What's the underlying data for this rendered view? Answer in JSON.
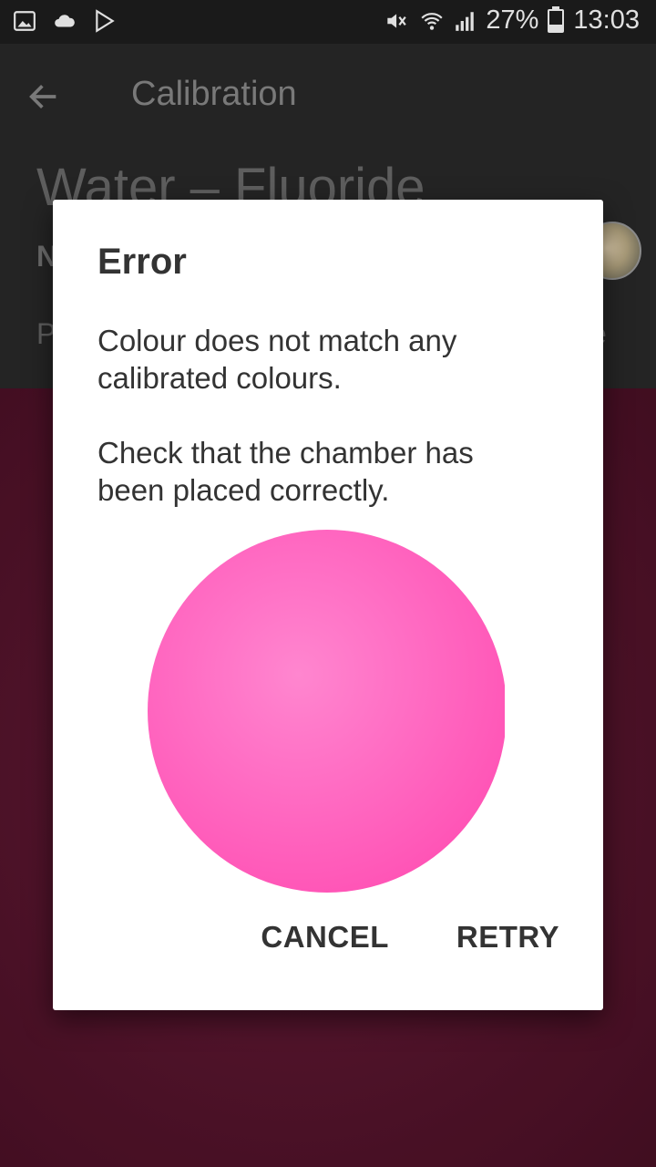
{
  "status_bar": {
    "battery": "27%",
    "time": "13:03",
    "icons": [
      "gallery-icon",
      "cloud-icon",
      "play-store-icon",
      "mute-icon",
      "wifi-icon",
      "signal-icon",
      "battery-icon"
    ]
  },
  "app_bar": {
    "title": "Calibration",
    "back_icon": "arrow-left-icon"
  },
  "background": {
    "heading": "Water – Fluoride",
    "bold_label": "N",
    "text_left": "P",
    "text_right": "e",
    "swatch_color": "#5b1630"
  },
  "dialog": {
    "title": "Error",
    "message": "Colour does not match any\ncalibrated colours.\n\nCheck that the chamber has\nbeen placed correctly.",
    "circle_color": "#ff64bd",
    "cancel_label": "CANCEL",
    "retry_label": "RETRY"
  }
}
